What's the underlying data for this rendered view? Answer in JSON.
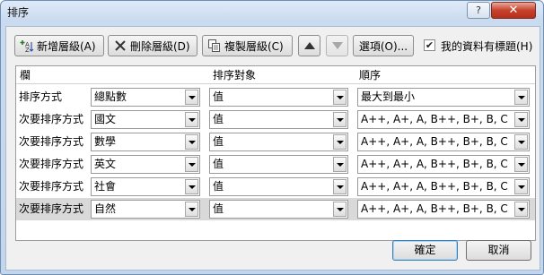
{
  "window": {
    "title": "排序",
    "help_label": "?",
    "close_label": "✕"
  },
  "toolbar": {
    "add_level": "新增層級(A)",
    "delete_level": "刪除層級(D)",
    "copy_level": "複製層級(C)",
    "options": "選項(O)...",
    "header_checkbox_label": "我的資料有標題(H)",
    "header_checkbox_checked": true,
    "move_up_icon": "triangle-up",
    "move_down_icon": "triangle-down"
  },
  "grid": {
    "headers": {
      "column": "欄",
      "sort_on": "排序對象",
      "order": "順序"
    },
    "rows": [
      {
        "label": "排序方式",
        "column": "總點數",
        "sort_on": "值",
        "order": "最大到最小"
      },
      {
        "label": "次要排序方式",
        "column": "國文",
        "sort_on": "值",
        "order": "A++, A+, A, B++, B+, B, C"
      },
      {
        "label": "次要排序方式",
        "column": "數學",
        "sort_on": "值",
        "order": "A++, A+, A, B++, B+, B, C"
      },
      {
        "label": "次要排序方式",
        "column": "英文",
        "sort_on": "值",
        "order": "A++, A+, A, B++, B+, B, C"
      },
      {
        "label": "次要排序方式",
        "column": "社會",
        "sort_on": "值",
        "order": "A++, A+, A, B++, B+, B, C"
      },
      {
        "label": "次要排序方式",
        "column": "自然",
        "sort_on": "值",
        "order": "A++, A+, A, B++, B+, B, C"
      }
    ]
  },
  "footer": {
    "ok": "確定",
    "cancel": "取消"
  }
}
